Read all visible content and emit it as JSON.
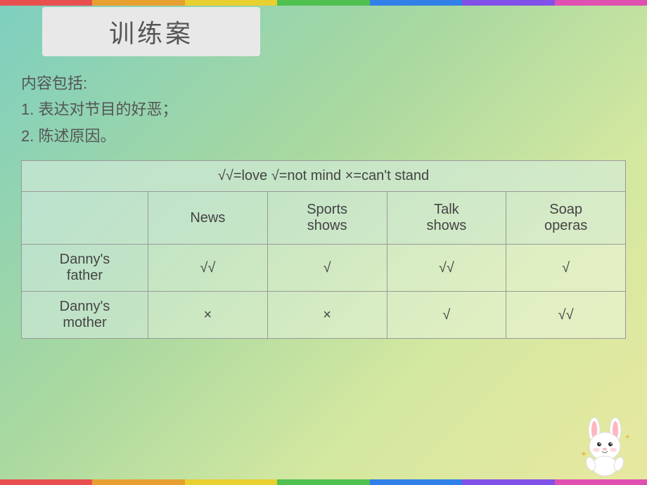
{
  "topBars": [
    {
      "color": "#e85050"
    },
    {
      "color": "#e8a030"
    },
    {
      "color": "#e8d030"
    },
    {
      "color": "#50c050"
    },
    {
      "color": "#3080e8"
    },
    {
      "color": "#8050e8"
    },
    {
      "color": "#e050b0"
    }
  ],
  "title": "训练案",
  "intro": {
    "line0": "内容包括:",
    "line1": "1. 表达对节目的好恶；",
    "line2": "2. 陈述原因。"
  },
  "legend": "√√=love   √=not mind   ×=can't stand",
  "tableHeaders": [
    "",
    "News",
    "Sports\nshows",
    "Talk\nshows",
    "Soap\noperas"
  ],
  "rows": [
    {
      "label": "Danny's\nfather",
      "cells": [
        "√√",
        "√",
        "√√",
        "√"
      ]
    },
    {
      "label": "Danny's\nmother",
      "cells": [
        "×",
        "×",
        "√",
        "√√"
      ]
    }
  ]
}
